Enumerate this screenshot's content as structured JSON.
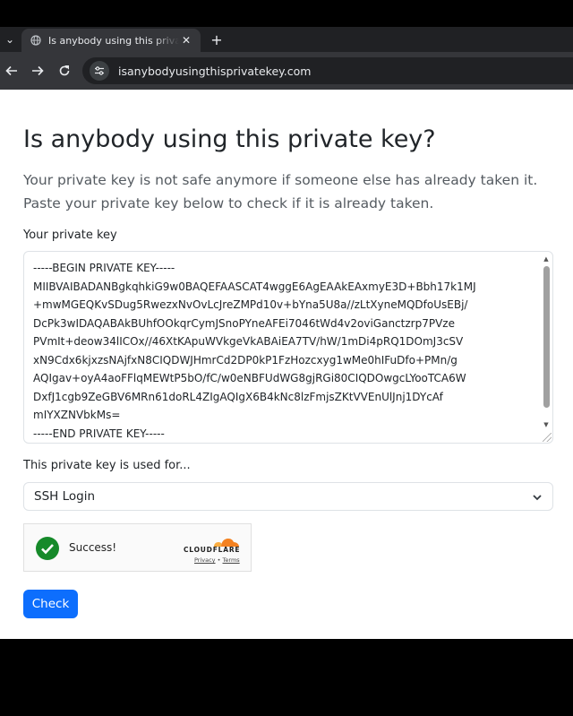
{
  "browser": {
    "tab_title": "Is anybody using this private key?",
    "tab_close": "✕",
    "new_tab": "+",
    "tab_menu": "⌄",
    "url": "isanybodyusingthisprivatekey.com"
  },
  "page": {
    "heading": "Is anybody using this private key?",
    "lead_line1": "Your private key is not safe anymore if someone else has already taken it.",
    "lead_line2": "Paste your private key below to check if it is already taken.",
    "key_label": "Your private key",
    "key_value": "-----BEGIN PRIVATE KEY-----\nMIIBVAIBADANBgkqhkiG9w0BAQEFAASCAT4wggE6AgEAAkEAxmyE3D+Bbh17k1MJ\n+mwMGEQKvSDug5RwezxNvOvLcJreZMPd10v+bYna5U8a//zLtXyneMQDfoUsEBj/\nDcPk3wIDAQABAkBUhfOOkqrCymJSnoPYneAFEi7046tWd4v2oviGanctzrp7PVze\nPVmIt+deow34lICOx//46XtKApuWVkgeVkABAiEA7TV/hW/1mDi4pRQ1DOmJ3cSV\nxN9Cdx6kjxzsNAjfxN8CIQDWJHmrCd2DP0kP1FzHozcxyg1wMe0hIFuDfo+PMn/g\nAQIgav+oyA4aoFFlqMEWtP5bO/fC/w0eNBFUdWG8gjRGi80CIQDOwgcLYooTCA6W\nDxfJ1cgb9ZeGBV6MRn61doRL4ZIgAQIgX6B4kNc8lzFmjsZKtVVEnUlJnj1DYcAf\nmIYXZNVbkMs=\n-----END PRIVATE KEY-----",
    "usage_label": "This private key is used for...",
    "usage_value": "SSH Login",
    "captcha_status": "Success!",
    "captcha_brand": "CLOUDFLARE",
    "captcha_privacy": "Privacy",
    "captcha_sep": " • ",
    "captcha_terms": "Terms",
    "check_button": "Check"
  },
  "colors": {
    "primary": "#0d6efd",
    "success": "#168a2a",
    "cloudflare_orange": "#f48120"
  }
}
